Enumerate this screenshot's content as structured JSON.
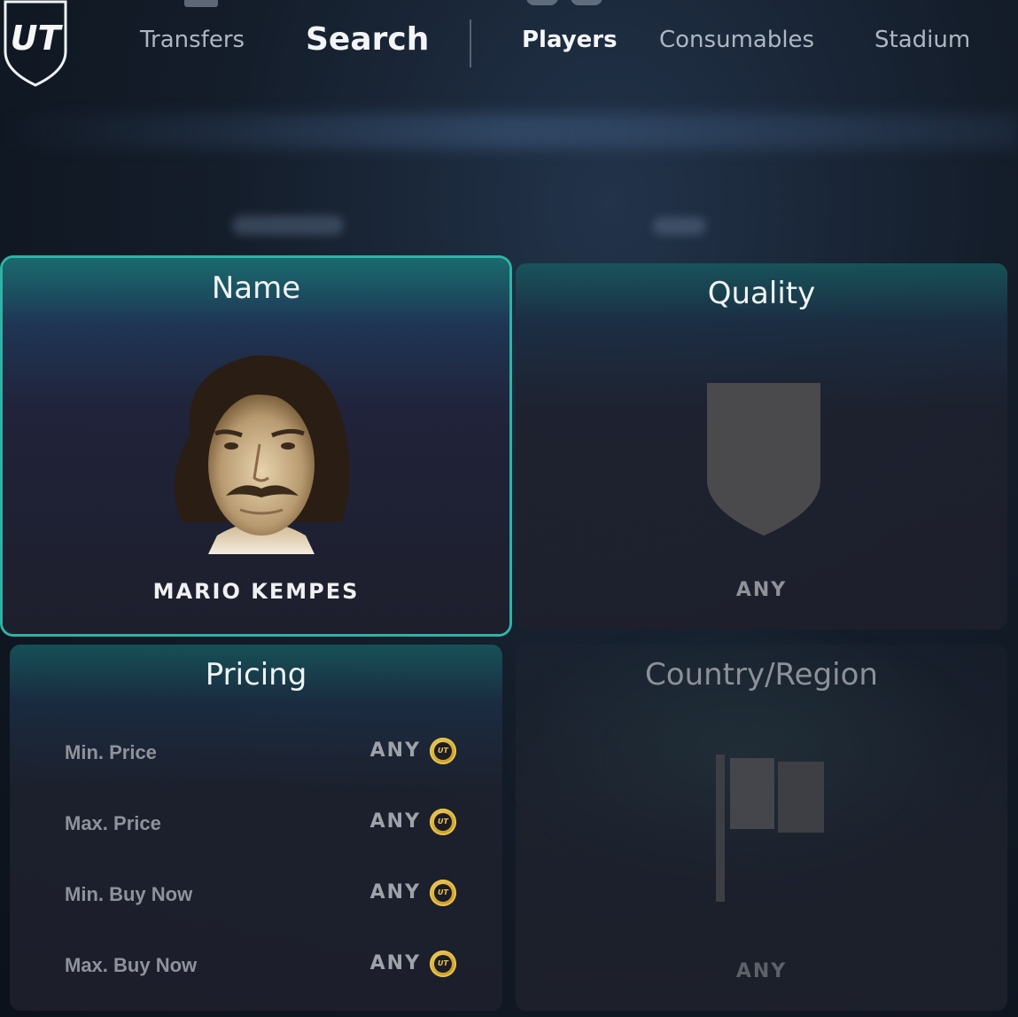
{
  "nav": {
    "transfers": "Transfers",
    "search": "Search",
    "players": "Players",
    "consumables": "Consumables",
    "stadium": "Stadium"
  },
  "logo": {
    "text": "UT"
  },
  "cards": {
    "name": {
      "title": "Name",
      "value": "MARIO KEMPES"
    },
    "quality": {
      "title": "Quality",
      "value": "ANY"
    },
    "pricing": {
      "title": "Pricing",
      "rows": [
        {
          "label": "Min. Price",
          "value": "ANY"
        },
        {
          "label": "Max. Price",
          "value": "ANY"
        },
        {
          "label": "Min. Buy Now",
          "value": "ANY"
        },
        {
          "label": "Max. Buy Now",
          "value": "ANY"
        }
      ]
    },
    "country": {
      "title": "Country/Region",
      "value": "ANY"
    }
  },
  "colors": {
    "accent": "#2fb3a7",
    "coin_gold": "#e7c24d",
    "muted_text": "#8e939b"
  },
  "icons": {
    "logo": "ut-shield-logo",
    "coin": "ut-coin-icon",
    "quality_placeholder": "shield-icon",
    "country_placeholder": "flag-icon"
  }
}
